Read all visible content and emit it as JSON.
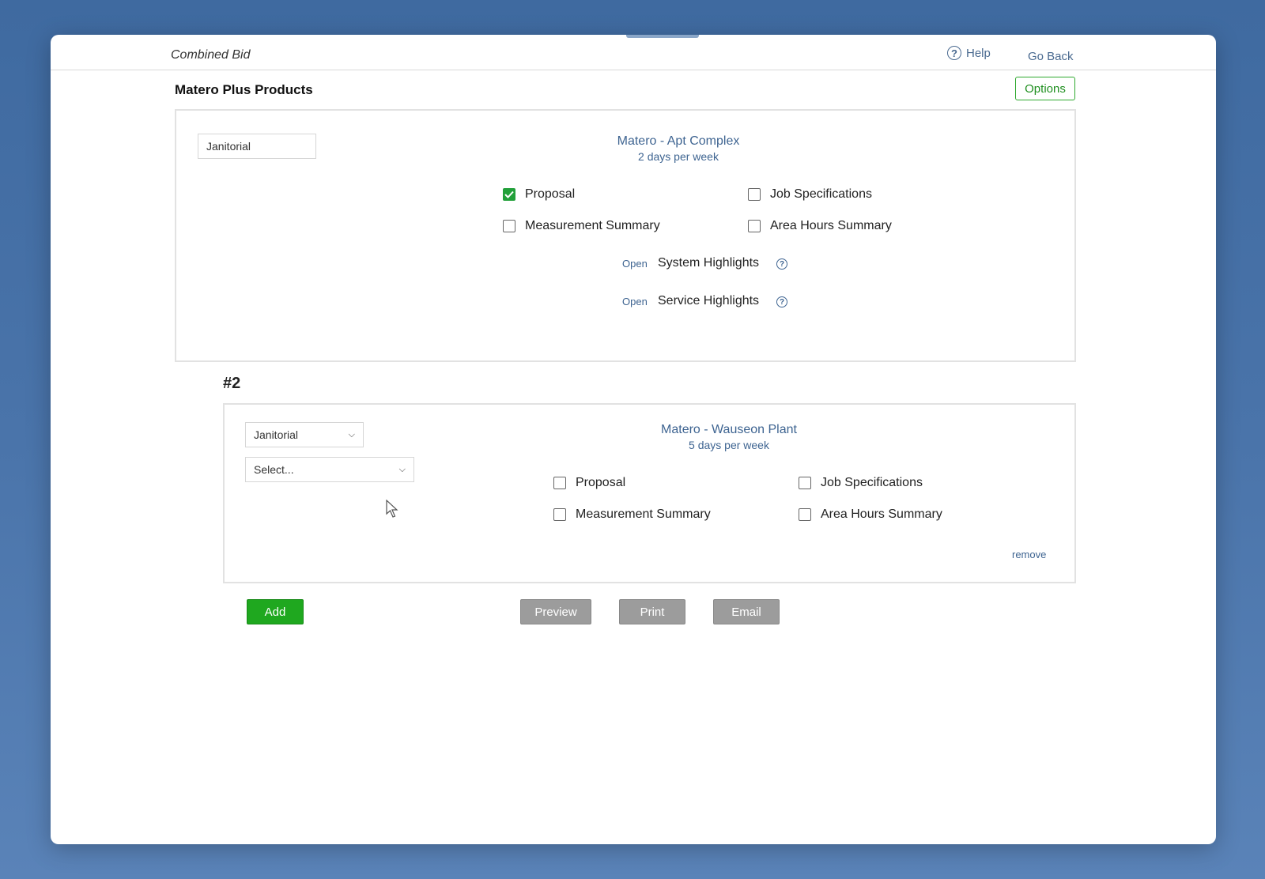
{
  "header": {
    "app_title": "Combined Bid",
    "help_label": "Help",
    "goback_label": "Go Back"
  },
  "section": {
    "title": "Matero Plus Products",
    "options_label": "Options"
  },
  "bids": [
    {
      "service_value": "Janitorial",
      "location": "Matero - Apt Complex",
      "frequency": "2 days per week",
      "checks": [
        {
          "label": "Proposal",
          "checked": true
        },
        {
          "label": "Job Specifications",
          "checked": false
        },
        {
          "label": "Measurement Summary",
          "checked": false
        },
        {
          "label": "Area Hours Summary",
          "checked": false
        }
      ],
      "highlights": [
        {
          "open": "Open",
          "label": "System Highlights"
        },
        {
          "open": "Open",
          "label": "Service Highlights"
        }
      ]
    },
    {
      "number": "#2",
      "service_value": "Janitorial",
      "second_select": "Select...",
      "location": "Matero - Wauseon Plant",
      "frequency": "5 days per week",
      "checks": [
        {
          "label": "Proposal",
          "checked": false
        },
        {
          "label": "Job Specifications",
          "checked": false
        },
        {
          "label": "Measurement Summary",
          "checked": false
        },
        {
          "label": "Area Hours Summary",
          "checked": false
        }
      ],
      "remove_label": "remove"
    }
  ],
  "actions": {
    "add": "Add",
    "preview": "Preview",
    "print": "Print",
    "email": "Email"
  },
  "colors": {
    "accent_green": "#1fa81f",
    "link_blue": "#3e6491",
    "button_gray": "#9c9c9c"
  }
}
